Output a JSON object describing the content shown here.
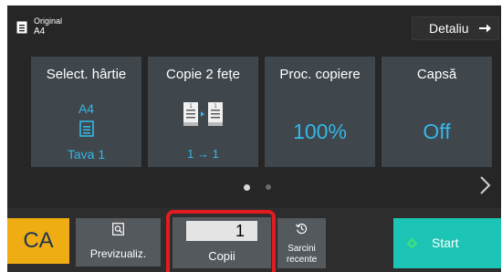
{
  "original": {
    "label": "Original",
    "paper": "A4"
  },
  "detail_button": {
    "label": "Detaliu"
  },
  "tiles": {
    "paper": {
      "title": "Select. hârtie",
      "size": "A4",
      "tray": "Tava 1"
    },
    "duplex": {
      "title": "Copie 2 fețe",
      "mode": "1 → 1"
    },
    "ratio": {
      "title": "Proc. copiere",
      "value": "100%"
    },
    "staple": {
      "title": "Capsă",
      "value": "Off"
    }
  },
  "pager": {
    "pages": 2,
    "current": 1
  },
  "bottom_bar": {
    "ca_label": "CA",
    "preview_label": "Previzualiz.",
    "copies_value": "1",
    "copies_label": "Copii",
    "recent_label_line1": "Sarcini",
    "recent_label_line2": "recente",
    "start_label": "Start"
  },
  "colors": {
    "accent_blue": "#35b8e8",
    "ca_orange": "#f0ad13",
    "start_teal": "#1cc4b5",
    "highlight_red": "#e21b21"
  },
  "icons": {
    "original": "document-icon",
    "detail": "arrow-right-icon",
    "tray": "paper-tray-icon",
    "duplex": "duplex-copy-icon",
    "next_page": "chevron-right-icon",
    "preview": "preview-magnifier-icon",
    "recent": "history-icon",
    "start": "start-diamond-icon"
  }
}
